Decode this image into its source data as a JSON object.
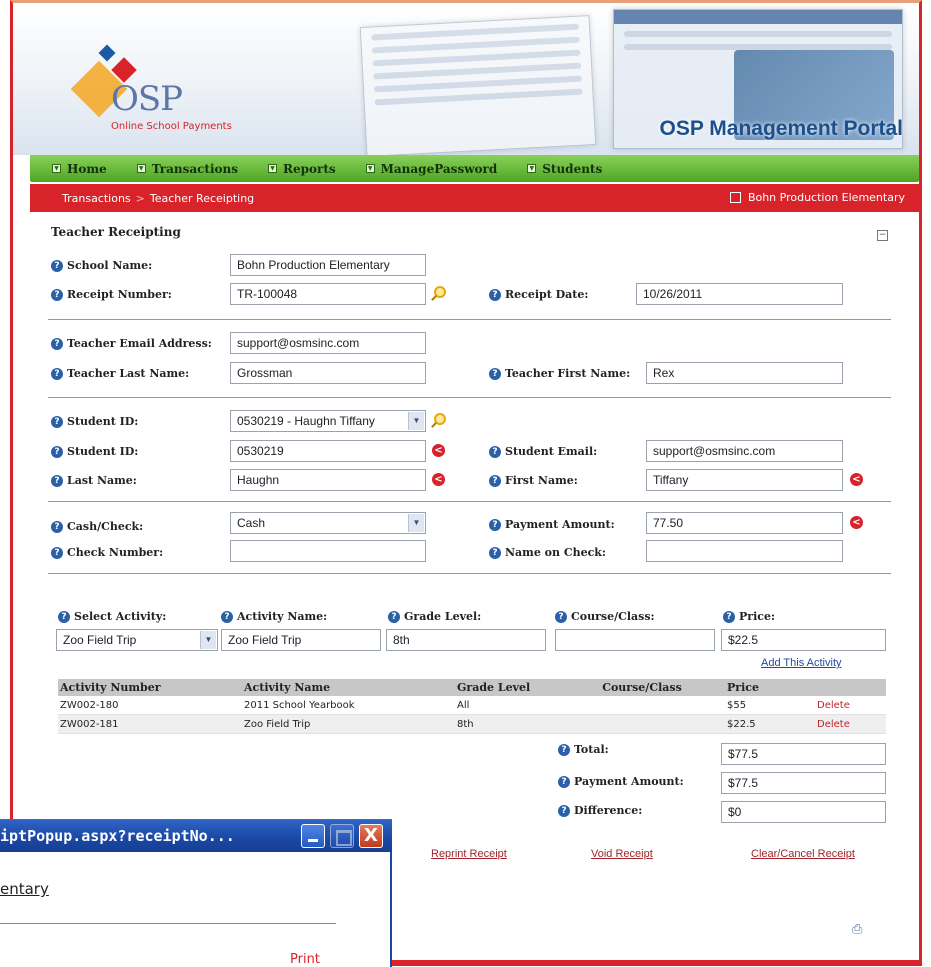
{
  "header": {
    "logo_text": "OSP",
    "logo_sub": "Online School Payments",
    "portal_title": "OSP Management Portal"
  },
  "nav": {
    "items": [
      "Home",
      "Transactions",
      "Reports",
      "ManagePassword",
      "Students"
    ]
  },
  "breadcrumb": {
    "section": "Transactions",
    "separator": ">",
    "page": "Teacher Receipting",
    "school": "Bohn Production Elementary"
  },
  "form": {
    "title": "Teacher Receipting",
    "school_name": {
      "label": "School Name:",
      "value": "Bohn Production Elementary"
    },
    "receipt_number": {
      "label": "Receipt Number:",
      "value": "TR-100048"
    },
    "receipt_date": {
      "label": "Receipt Date:",
      "value": "10/26/2011"
    },
    "teacher_email": {
      "label": "Teacher Email Address:",
      "value": "support@osmsinc.com"
    },
    "teacher_last": {
      "label": "Teacher Last Name:",
      "value": "Grossman"
    },
    "teacher_first": {
      "label": "Teacher First Name:",
      "value": "Rex"
    },
    "student_select": {
      "label": "Student ID:",
      "value": "0530219 - Haughn Tiffany"
    },
    "student_id": {
      "label": "Student ID:",
      "value": "0530219"
    },
    "student_email": {
      "label": "Student Email:",
      "value": "support@osmsinc.com"
    },
    "last_name": {
      "label": "Last Name:",
      "value": "Haughn"
    },
    "first_name": {
      "label": "First Name:",
      "value": "Tiffany"
    },
    "cash_check": {
      "label": "Cash/Check:",
      "value": "Cash"
    },
    "payment_amount": {
      "label": "Payment Amount:",
      "value": "77.50"
    },
    "check_number": {
      "label": "Check Number:",
      "value": ""
    },
    "name_on_check": {
      "label": "Name on Check:",
      "value": ""
    }
  },
  "activity": {
    "select_label": "Select Activity:",
    "select_value": "Zoo Field Trip",
    "name_label": "Activity Name:",
    "name_value": "Zoo Field Trip",
    "grade_label": "Grade Level:",
    "grade_value": "8th",
    "course_label": "Course/Class:",
    "course_value": "",
    "price_label": "Price:",
    "price_value": "$22.5",
    "add_link": "Add This Activity"
  },
  "table": {
    "headers": [
      "Activity Number",
      "Activity Name",
      "Grade Level",
      "Course/Class",
      "Price",
      ""
    ],
    "rows": [
      [
        "ZW002-180",
        "2011 School Yearbook",
        "All",
        "",
        "$55",
        "Delete"
      ],
      [
        "ZW002-181",
        "Zoo Field Trip",
        "8th",
        "",
        "$22.5",
        "Delete"
      ]
    ]
  },
  "totals": {
    "total_label": "Total:",
    "total_value": "$77.5",
    "payment_label": "Payment Amount:",
    "payment_value": "$77.5",
    "diff_label": "Difference:",
    "diff_value": "$0"
  },
  "actions": {
    "reprint": "Reprint Receipt",
    "void": "Void Receipt",
    "clear": "Clear/Cancel Receipt"
  },
  "popup": {
    "title": "iptPopup.aspx?receiptNo...",
    "school": "entary",
    "print": "Print",
    "close_glyph": "X"
  },
  "icons": {
    "help": "?",
    "error": "<",
    "collapse": "-"
  },
  "colors": {
    "accent_red": "#d8232a",
    "nav_green": "#4ea524",
    "title_blue": "#1c4f8c"
  }
}
